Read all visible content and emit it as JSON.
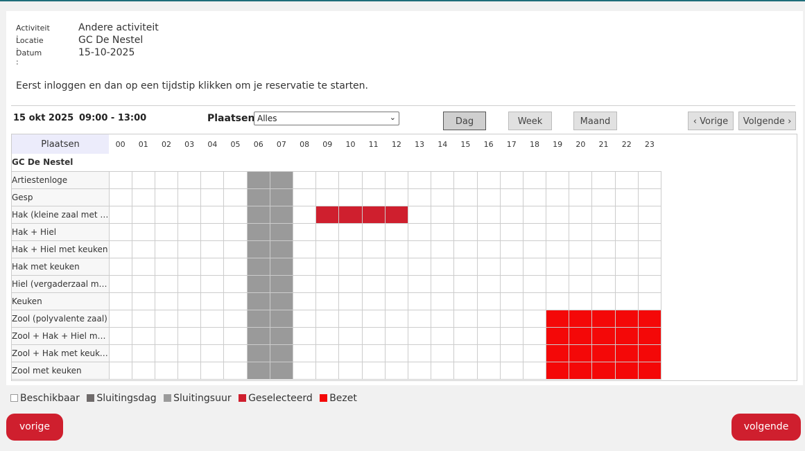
{
  "info": {
    "activiteit_label": "Activiteit :",
    "activiteit_value": "Andere activiteit",
    "locatie_label": "Locatie :",
    "locatie_value": "GC De Nestel",
    "datum_label": "Datum :",
    "datum_value": "15-10-2025"
  },
  "intro": "Eerst inloggen en dan op een tijdstip klikken om je reservatie te starten.",
  "toolbar": {
    "date": "15 okt 2025",
    "time": "09:00 - 13:00",
    "plaatsen_label": "Plaatsen",
    "plaatsen_value": "Alles",
    "dag": "Dag",
    "week": "Week",
    "maand": "Maand",
    "vorige": "Vorige",
    "volgende": "Volgende"
  },
  "grid": {
    "header_label": "Plaatsen",
    "hours": [
      "00",
      "01",
      "02",
      "03",
      "04",
      "05",
      "06",
      "07",
      "08",
      "09",
      "10",
      "11",
      "12",
      "13",
      "14",
      "15",
      "16",
      "17",
      "18",
      "19",
      "20",
      "21",
      "22",
      "23"
    ],
    "group": "GC De Nestel",
    "rows": [
      {
        "name": "Artiestenloge",
        "sel": [],
        "busy": []
      },
      {
        "name": "Gesp",
        "sel": [],
        "busy": []
      },
      {
        "name": "Hak (kleine zaal met t…",
        "sel": [
          9,
          10,
          11,
          12
        ],
        "busy": []
      },
      {
        "name": "Hak + Hiel",
        "sel": [],
        "busy": []
      },
      {
        "name": "Hak + Hiel met keuken",
        "sel": [],
        "busy": []
      },
      {
        "name": "Hak met keuken",
        "sel": [],
        "busy": []
      },
      {
        "name": "Hiel (vergaderzaal m…",
        "sel": [],
        "busy": []
      },
      {
        "name": "Keuken",
        "sel": [],
        "busy": []
      },
      {
        "name": "Zool (polyvalente zaal)",
        "sel": [],
        "busy": [
          19,
          20,
          21,
          22,
          23
        ]
      },
      {
        "name": "Zool + Hak + Hiel met …",
        "sel": [],
        "busy": [
          19,
          20,
          21,
          22,
          23
        ]
      },
      {
        "name": "Zool + Hak met keuke…",
        "sel": [],
        "busy": [
          19,
          20,
          21,
          22,
          23
        ]
      },
      {
        "name": "Zool met keuken",
        "sel": [],
        "busy": [
          19,
          20,
          21,
          22,
          23
        ]
      }
    ],
    "closed_hours": [
      6,
      7
    ]
  },
  "legend": {
    "beschikbaar": "Beschikbaar",
    "sluitingsdag": "Sluitingsdag",
    "sluitingsuur": "Sluitingsuur",
    "geselecteerd": "Geselecteerd",
    "bezet": "Bezet"
  },
  "colors": {
    "selected": "#cf1f2e",
    "busy": "#f40808",
    "closed_hour": "#9a9a9a",
    "closed_day": "#6f6b6b",
    "button_red": "#cf1f2e"
  },
  "nav": {
    "prev": "vorige",
    "next": "volgende"
  }
}
